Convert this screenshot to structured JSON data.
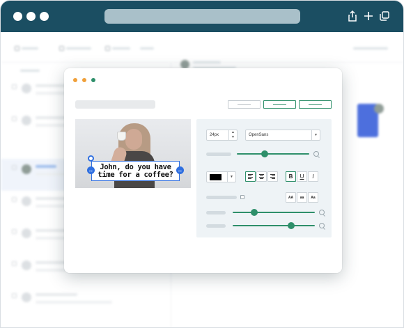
{
  "colors": {
    "titlebar": "#1b4e62",
    "accent": "#2e8f6a",
    "selection": "#2f6fe0",
    "window_dots": [
      "#f0a03a",
      "#f0a03a",
      "#2e8f6a"
    ],
    "text_color_swatch": "#000000"
  },
  "browser": {
    "icons": [
      "share-icon",
      "plus-icon",
      "tabs-icon"
    ]
  },
  "editor": {
    "caption": "John, do you have time for a coffee?",
    "font_size": "24px",
    "font_family": "OpenSans",
    "case_buttons": [
      "AA",
      "aa",
      "Aa"
    ],
    "style_buttons": [
      "B",
      "U",
      "I"
    ],
    "sliders": [
      {
        "name": "slider-1",
        "value": 0.38
      },
      {
        "name": "slider-2",
        "value": 0.26
      },
      {
        "name": "slider-3",
        "value": 0.71
      }
    ],
    "alignment": "left",
    "bold": true
  }
}
